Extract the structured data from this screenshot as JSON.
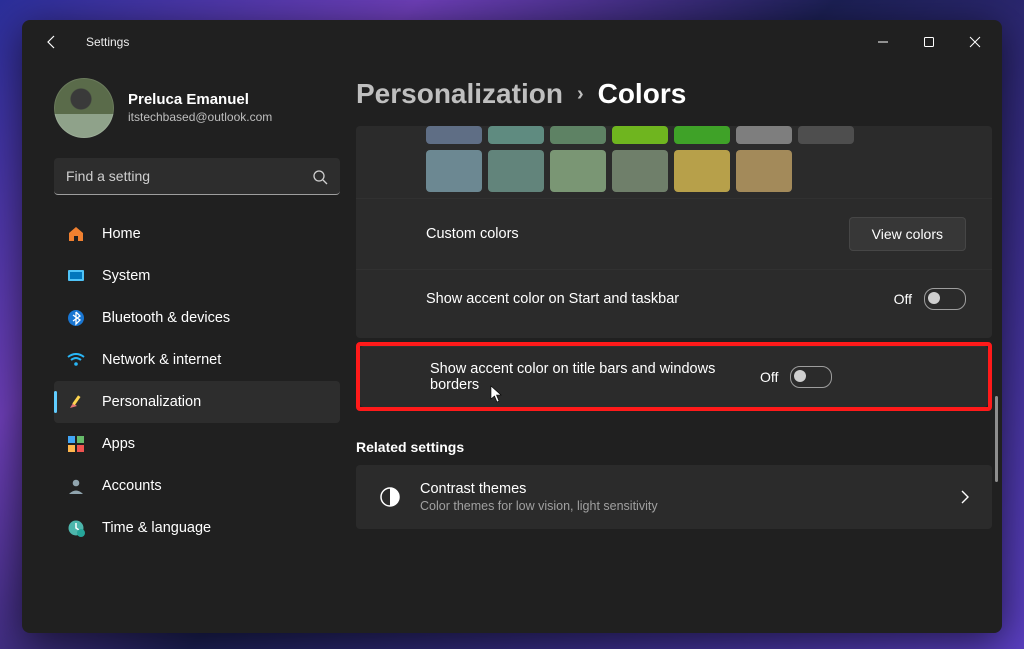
{
  "title": "Settings",
  "profile": {
    "name": "Preluca Emanuel",
    "email": "itstechbased@outlook.com"
  },
  "search": {
    "placeholder": "Find a setting"
  },
  "sidebar": {
    "items": [
      {
        "label": "Home"
      },
      {
        "label": "System"
      },
      {
        "label": "Bluetooth & devices"
      },
      {
        "label": "Network & internet"
      },
      {
        "label": "Personalization"
      },
      {
        "label": "Apps"
      },
      {
        "label": "Accounts"
      },
      {
        "label": "Time & language"
      }
    ]
  },
  "breadcrumb": {
    "parent": "Personalization",
    "current": "Colors"
  },
  "swatches": {
    "row1": [
      "#5f6e85",
      "#5f8b80",
      "#5e8264",
      "#6fb51f",
      "#3fa228",
      "#7e7e7e",
      "#4e4e4e"
    ],
    "row2": [
      "#6c8892",
      "#62847b",
      "#7a9674",
      "#6f7f6a",
      "#b7a04a",
      "#a38a5a"
    ]
  },
  "content": {
    "custom_colors": "Custom colors",
    "view_colors": "View colors",
    "accent_start": "Show accent color on Start and taskbar",
    "accent_title": "Show accent color on title bars and windows borders",
    "off": "Off",
    "related": "Related settings",
    "contrast": {
      "title": "Contrast themes",
      "sub": "Color themes for low vision, light sensitivity"
    }
  }
}
